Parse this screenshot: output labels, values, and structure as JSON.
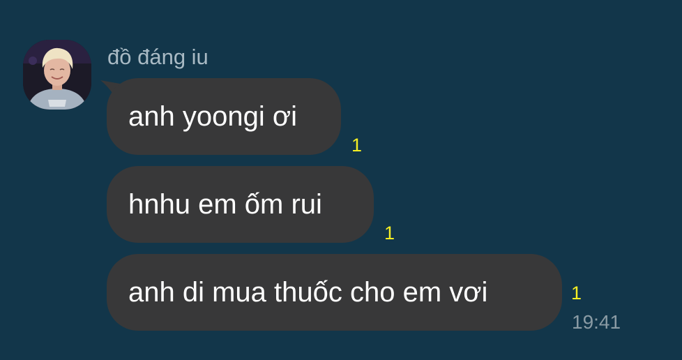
{
  "chat": {
    "sender": {
      "name": "đồ đáng iu",
      "avatar": "profile-photo"
    },
    "messages": [
      {
        "text": "anh yoongi ơi",
        "unread_count": "1"
      },
      {
        "text": "hnhu em ốm rui",
        "unread_count": "1"
      },
      {
        "text": "anh di mua thuốc cho em vơi",
        "unread_count": "1"
      }
    ],
    "timestamp": "19:41"
  },
  "colors": {
    "background": "#12364a",
    "bubble": "#383839",
    "message_text": "#ffffff",
    "unread_count": "#f6ef23",
    "sender_name": "#a9bac4",
    "timestamp": "#8a9ba4"
  }
}
